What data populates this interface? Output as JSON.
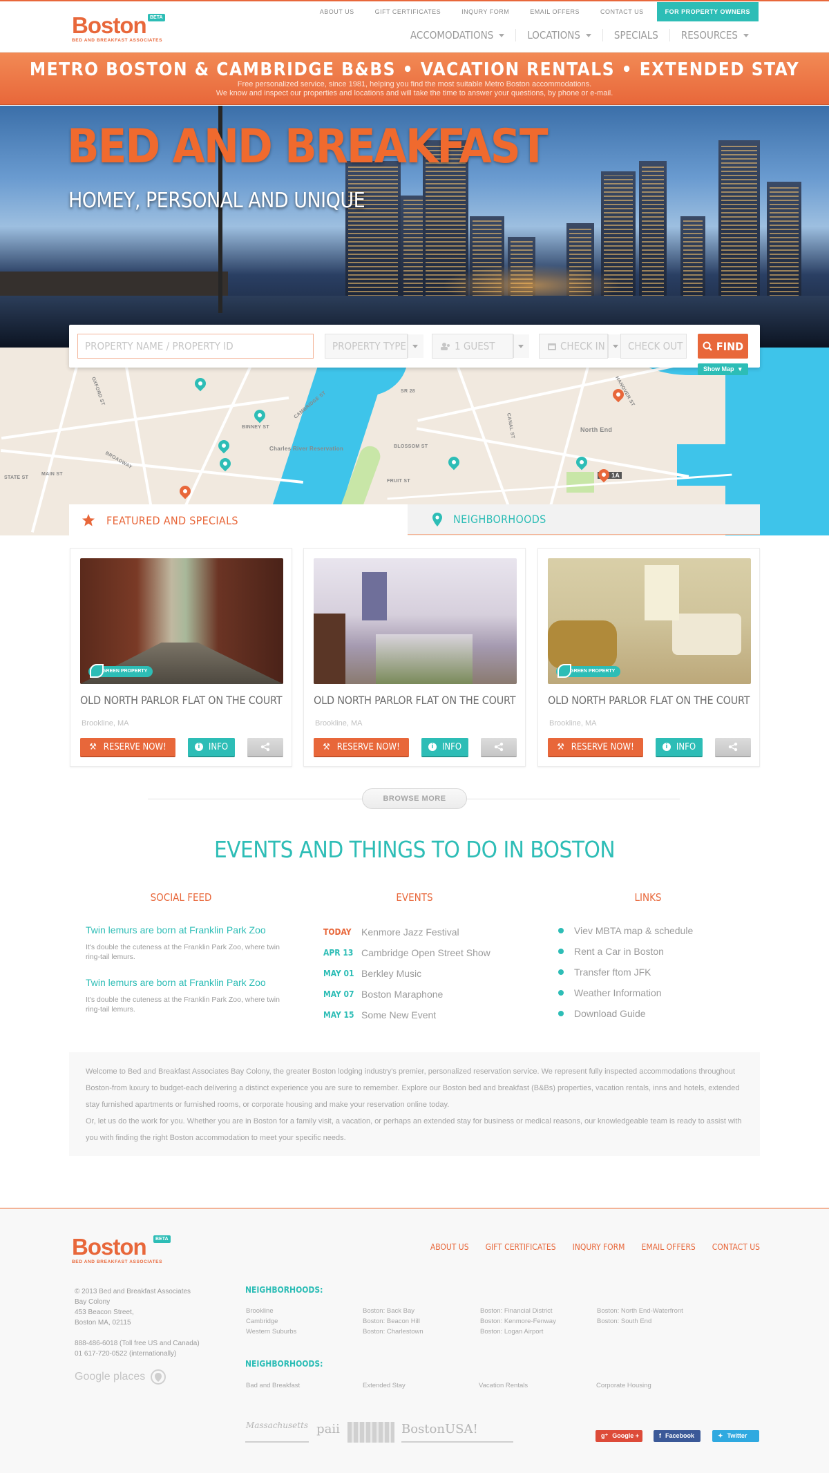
{
  "brand": {
    "name": "Boston",
    "beta": "BETA",
    "tagline": "BED AND BREAKFAST ASSOCIATES"
  },
  "top_nav": [
    "ABOUT US",
    "GIFT CERTIFICATES",
    "INQURY FORM",
    "EMAIL OFFERS",
    "CONTACT US"
  ],
  "owners_button": "FOR PROPERTY OWNERS",
  "main_nav": [
    "ACCOMODATIONS",
    "LOCATIONS",
    "SPECIALS",
    "RESOURCES"
  ],
  "band": {
    "headline": "METRO BOSTON & CAMBRIDGE B&BS  •  VACATION RENTALS  •  EXTENDED STAY",
    "line1": "Free personalized service, since 1981, helping you find the most suitable Metro Boston accommodations.",
    "line2": "We know and inspect our properties and locations and will take the time to answer your questions, by phone or e-mail."
  },
  "hero": {
    "title": "BED AND BREAKFAST",
    "subtitle": "HOMEY, PERSONAL AND UNIQUE"
  },
  "search": {
    "name_placeholder": "PROPERTY NAME / PROPERTY ID",
    "type": "PROPERTY TYPE",
    "guests": "1 GUEST",
    "check_in": "CHECK IN",
    "check_out": "CHECK OUT",
    "find": "FIND",
    "show_map": "Show Map"
  },
  "map_labels": [
    "Charles River Reservation",
    "North End",
    "MA 1A",
    "BROADWAY",
    "MAIN ST",
    "STATE ST",
    "FRUIT ST",
    "BLOSSOM ST",
    "CAMBRIDGE ST",
    "SR 28",
    "BINNEY ST",
    "OXFORD ST",
    "HANOVER ST",
    "CANAL ST"
  ],
  "tabs": {
    "featured": "FEATURED AND SPECIALS",
    "neighborhoods": "NEIGHBORHOODS"
  },
  "cards": [
    {
      "badge": "GREEN PROPERTY",
      "title": "OLD NORTH PARLOR FLAT ON THE COURT",
      "location": "Brookline, MA",
      "reserve": "RESERVE NOW!",
      "info": "INFO"
    },
    {
      "badge": "",
      "title": "OLD NORTH PARLOR FLAT ON THE COURT",
      "location": "Brookline, MA",
      "reserve": "RESERVE NOW!",
      "info": "INFO"
    },
    {
      "badge": "GREEN PROPERTY",
      "title": "OLD NORTH PARLOR FLAT ON THE COURT",
      "location": "Brookline, MA",
      "reserve": "RESERVE NOW!",
      "info": "INFO"
    }
  ],
  "browse_more": "BROWSE MORE",
  "events_section": {
    "title": "EVENTS AND THINGS TO DO IN BOSTON",
    "social_title": "SOCIAL FEED",
    "events_title": "EVENTS",
    "links_title": "LINKS",
    "feed": [
      {
        "title": "Twin lemurs are born at Franklin Park Zoo",
        "body": "It's double the cuteness at the Franklin Park Zoo, where twin ring-tail lemurs."
      },
      {
        "title": "Twin lemurs are born at Franklin Park Zoo",
        "body": "It's double the cuteness at the Franklin Park Zoo, where twin ring-tail lemurs."
      }
    ],
    "events": [
      {
        "date": "TODAY",
        "name": "Kenmore Jazz Festival"
      },
      {
        "date": "APR 13",
        "name": "Cambridge Open Street Show"
      },
      {
        "date": "MAY 01",
        "name": "Berkley Music"
      },
      {
        "date": "MAY 07",
        "name": "Boston Maraphone"
      },
      {
        "date": "MAY 15",
        "name": "Some New Event"
      }
    ],
    "links": [
      "Viev MBTA map & schedule",
      "Rent a Car in Boston",
      "Transfer ftom JFK",
      "Weather Information",
      "Download Guide"
    ]
  },
  "welcome": {
    "p1": "Welcome to Bed and Breakfast Associates Bay Colony, the greater Boston lodging industry's premier, personalized reservation service. We represent fully inspected accommodations throughout Boston-from luxury to budget-each delivering a distinct experience you are sure to remember. Explore our Boston bed and breakfast (B&Bs) properties, vacation rentals, inns and hotels, extended stay furnished apartments or furnished rooms, or corporate housing and make your reservation online today.",
    "p2": "Or, let us do the work for you. Whether you are in Boston for a family visit, a vacation, or perhaps an extended stay for business or medical reasons, our knowledgeable team is ready to assist with you with finding the right Boston accommodation to meet your specific needs."
  },
  "footer": {
    "nav": [
      "ABOUT US",
      "GIFT CERTIFICATES",
      "INQURY FORM",
      "EMAIL OFFERS",
      "CONTACT US"
    ],
    "address": [
      "© 2013 Bed and Breakfast Associates",
      "Bay Colony",
      "453 Beacon Street,",
      "Boston MA, 02115",
      "",
      "888-486-6018 (Toll free US and Canada)",
      "01 617-720-0522 (internationally)"
    ],
    "google_places": "Google places",
    "neigh_title_1": "NEIGHBORHOODS:",
    "neigh_cols": [
      [
        "Brookline",
        "Cambridge",
        "Western Suburbs"
      ],
      [
        "Boston: Back Bay",
        "Boston: Beacon Hill",
        "Boston: Charlestown"
      ],
      [
        "Boston: Financial District",
        "Boston: Kenmore-Fenway",
        "Boston: Logan Airport"
      ],
      [
        "Boston: North End-Waterfront",
        "Boston: South End"
      ]
    ],
    "neigh_title_2": "NEIGHBORHOODS:",
    "types": [
      "Bad and Breakfast",
      "Extended Stay",
      "Vacation Rentals",
      "Corporate Housing"
    ],
    "partners": [
      "Massachusetts",
      "paii",
      "BostonUSA!"
    ],
    "social": [
      "Google +",
      "Facebook",
      "Twitter"
    ]
  },
  "colors": {
    "orange": "#e8673a",
    "teal": "#2dbdb6"
  }
}
